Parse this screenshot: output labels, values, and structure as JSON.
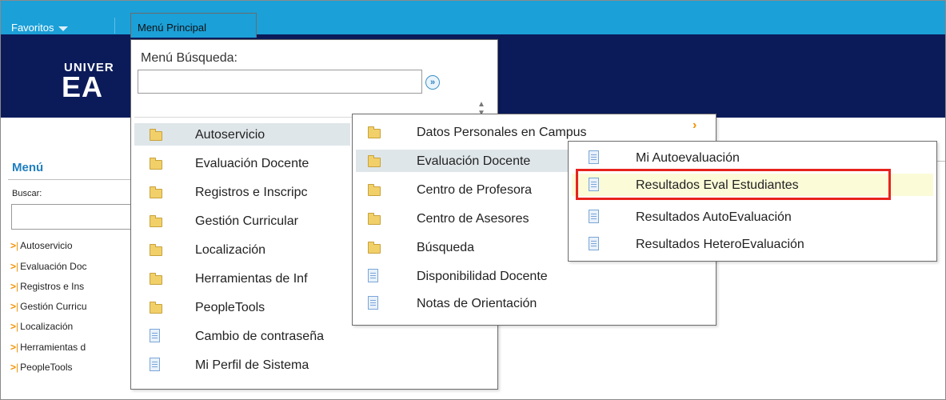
{
  "topbar": {
    "favorites": "Favoritos",
    "main_menu_tab": "Menú Principal"
  },
  "banner": {
    "logo_line1": "UNIVER",
    "logo_line2": "EA"
  },
  "sidebar": {
    "title": "Menú",
    "search_label": "Buscar:",
    "items": [
      "Autoservicio",
      "Evaluación Doc",
      "Registros e Ins",
      "Gestión Curricu",
      "Localización",
      "Herramientas d",
      "PeopleTools"
    ]
  },
  "main_menu": {
    "search_label": "Menú Búsqueda:",
    "search_go": "»",
    "items": [
      {
        "label": "Autoservicio",
        "icon": "folder-icon"
      },
      {
        "label": "Evaluación Docente",
        "icon": "folder-icon"
      },
      {
        "label": "Registros e Inscripc",
        "icon": "folder-icon"
      },
      {
        "label": "Gestión Curricular",
        "icon": "folder-icon"
      },
      {
        "label": "Localización",
        "icon": "folder-icon"
      },
      {
        "label": "Herramientas de Inf",
        "icon": "folder-icon"
      },
      {
        "label": "PeopleTools",
        "icon": "folder-icon"
      },
      {
        "label": "Cambio de contraseña",
        "icon": "page-icon"
      },
      {
        "label": "Mi Perfil de Sistema",
        "icon": "page-icon"
      }
    ]
  },
  "submenu_autoservicio": {
    "items": [
      {
        "label": "Datos Personales en Campus",
        "icon": "folder-icon"
      },
      {
        "label": "Evaluación Docente",
        "icon": "folder-icon"
      },
      {
        "label": "Centro de Profesora",
        "icon": "folder-icon"
      },
      {
        "label": "Centro de Asesores",
        "icon": "folder-icon"
      },
      {
        "label": "Búsqueda",
        "icon": "folder-icon"
      },
      {
        "label": "Disponibilidad Docente",
        "icon": "page-icon"
      },
      {
        "label": "Notas de Orientación",
        "icon": "page-icon"
      }
    ]
  },
  "submenu_evaluacion": {
    "items": [
      {
        "label": "Mi Autoevaluación",
        "icon": "page-icon"
      },
      {
        "label": "Resultados Eval Estudiantes",
        "icon": "page-icon"
      },
      {
        "label": "Resultados AutoEvaluación",
        "icon": "page-icon"
      },
      {
        "label": "Resultados HeteroEvaluación",
        "icon": "page-icon"
      }
    ]
  },
  "colors": {
    "topbar": "#1ba0d8",
    "banner": "#0b1b5a",
    "highlight": "#e8231e",
    "accent": "#f29100"
  }
}
